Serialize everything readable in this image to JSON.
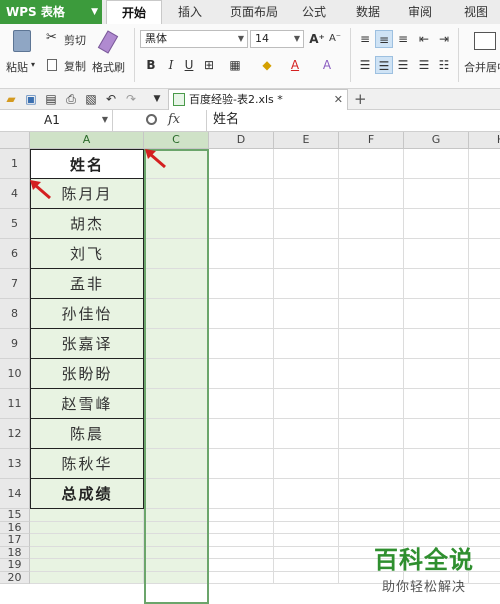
{
  "app": {
    "name": "WPS 表格",
    "brand_color": "#3c9b3c"
  },
  "ribbon_tabs": [
    "开始",
    "插入",
    "页面布局",
    "公式",
    "数据",
    "审阅",
    "视图"
  ],
  "active_tab": "开始",
  "clipboard": {
    "paste": "粘贴",
    "cut": "剪切",
    "copy": "复制",
    "format_painter": "格式刷"
  },
  "font": {
    "name": "黑体",
    "size": "14"
  },
  "merge_label": "合并居中",
  "document": {
    "tab_label": "百度经验-表2.xls *"
  },
  "namebox": {
    "value": "A1"
  },
  "formula": {
    "fx_label": "fx",
    "value": "姓名"
  },
  "columns": [
    "A",
    "C",
    "D",
    "E",
    "F",
    "G",
    "H"
  ],
  "rows": [
    {
      "num": "1",
      "value": "姓名",
      "bold": true
    },
    {
      "num": "4",
      "value": "陈月月"
    },
    {
      "num": "5",
      "value": "胡杰"
    },
    {
      "num": "6",
      "value": "刘飞"
    },
    {
      "num": "7",
      "value": "孟非"
    },
    {
      "num": "8",
      "value": "孙佳怡"
    },
    {
      "num": "9",
      "value": "张嘉译"
    },
    {
      "num": "10",
      "value": "张盼盼"
    },
    {
      "num": "11",
      "value": "赵雪峰"
    },
    {
      "num": "12",
      "value": "陈晨"
    },
    {
      "num": "13",
      "value": "陈秋华"
    },
    {
      "num": "14",
      "value": "总成绩",
      "bold": true
    },
    {
      "num": "15",
      "value": ""
    },
    {
      "num": "16",
      "value": ""
    },
    {
      "num": "17",
      "value": ""
    },
    {
      "num": "18",
      "value": ""
    },
    {
      "num": "19",
      "value": ""
    },
    {
      "num": "20",
      "value": ""
    }
  ],
  "watermark": {
    "title": "百科全说",
    "subtitle": "助你轻松解决"
  },
  "colors": {
    "selection_fill": "#e8f3e2",
    "selection_border": "#6ba56b",
    "arrow": "#d42020"
  }
}
